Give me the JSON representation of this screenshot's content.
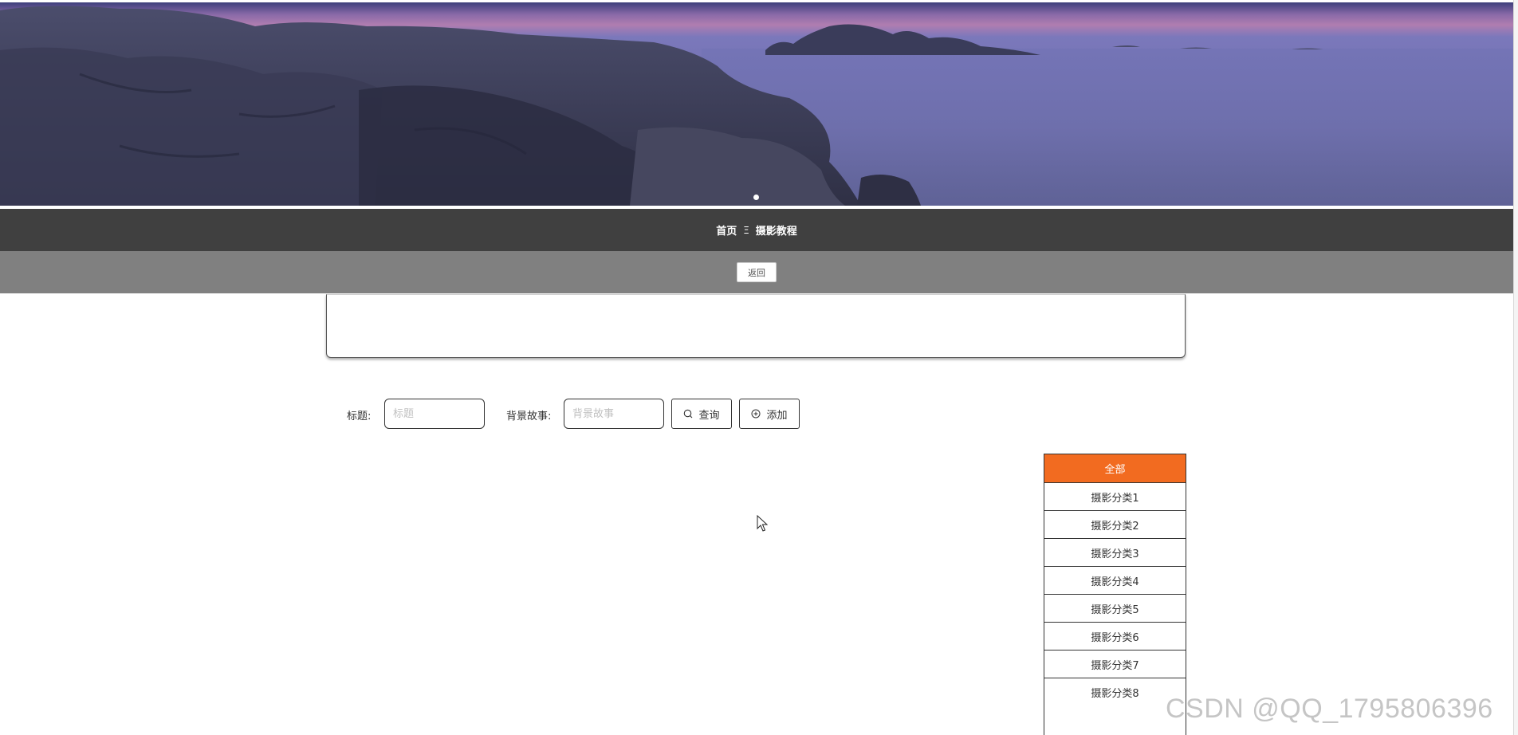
{
  "breadcrumb": {
    "home": "首页",
    "separator": "Ξ",
    "current": "摄影教程"
  },
  "back_button": {
    "label": "返回"
  },
  "search": {
    "title_label": "标题:",
    "title_placeholder": "标题",
    "title_value": "",
    "story_label": "背景故事:",
    "story_placeholder": "背景故事",
    "story_value": "",
    "query_button": "查询",
    "add_button": "添加"
  },
  "categories": {
    "items": [
      "全部",
      "摄影分类1",
      "摄影分类2",
      "摄影分类3",
      "摄影分类4",
      "摄影分类5",
      "摄影分类6",
      "摄影分类7",
      "摄影分类8"
    ],
    "active_index": 0
  },
  "banner": {
    "image": "coastal-rocks-at-dusk",
    "slide_count": 1,
    "active_slide": 0
  },
  "colors": {
    "nav_bar": "#404040",
    "sub_bar": "#808080",
    "accent": "#f26b20"
  },
  "watermark": "CSDN @QQ_1795806396"
}
